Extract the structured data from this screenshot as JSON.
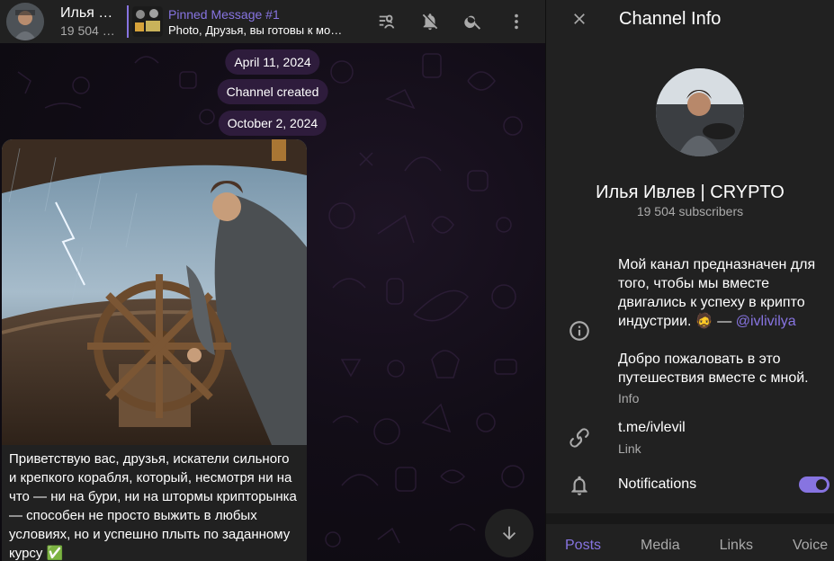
{
  "header": {
    "channel_name": "Илья Ивлев | CRYPTO",
    "subscribers_short": "19 504 subscribers",
    "pinned_title": "Pinned Message #1",
    "pinned_text": "Photo, Друзья, вы готовы к моему следующему шагу?",
    "actions": [
      "voice-chat-icon",
      "mute-icon",
      "search-icon",
      "more-icon"
    ]
  },
  "chat": {
    "dates": [
      "April 11, 2024",
      "October 2, 2024"
    ],
    "service_message": "Channel created",
    "post_text": "Приветствую вас, друзья, искатели сильного и крепкого корабля, который, несмотря ни на что — ни на бури, ни на штормы крипторынка — способен не просто выжить в любых условиях, но и успешно плыть по заданному курсу ✅"
  },
  "panel": {
    "title": "Channel Info",
    "name": "Илья Ивлев | CRYPTO",
    "subscribers": "19 504 subscribers",
    "description_p1": "Мой канал предназначен для того, чтобы мы вместе двигались к успеху в крипто индустрии. 🧔 — ",
    "description_mention": "@ivlivilya",
    "description_p2": "Добро пожаловать в это путешествия вместе с мной.",
    "info_label": "Info",
    "link_value": "t.me/ivlevil",
    "link_label": "Link",
    "notifications_label": "Notifications",
    "notifications_on": true,
    "accent_color": "#8774e1",
    "tabs": [
      "Posts",
      "Media",
      "Links",
      "Voice"
    ],
    "active_tab": "Posts"
  }
}
